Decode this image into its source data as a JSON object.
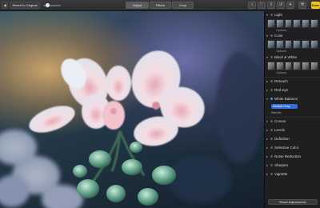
{
  "toolbar": {
    "left_label": "◀",
    "revert_label": "Revert to Original",
    "tabs": [
      {
        "label": "Adjust",
        "active": true
      },
      {
        "label": "Filters",
        "active": false
      },
      {
        "label": "Crop",
        "active": false
      }
    ],
    "right_icons": [
      "info-icon",
      "heart-icon",
      "share-icon",
      "rotate-icon",
      "enhance-icon",
      "wand-icon"
    ],
    "done_label": "Done",
    "zoom_level": 0.2
  },
  "panel": {
    "sections": [
      {
        "label": "Light",
        "has_thumbs": true,
        "options": "Options"
      },
      {
        "label": "Color",
        "has_thumbs": true,
        "options": "Options"
      },
      {
        "label": "Black & White",
        "has_thumbs": true,
        "options": "Options"
      },
      {
        "label": "Retouch"
      },
      {
        "label": "Red-eye"
      },
      {
        "label": "White Balance",
        "enabled": true
      },
      {
        "label": "Curves"
      },
      {
        "label": "Levels"
      },
      {
        "label": "Definition"
      },
      {
        "label": "Selective Color"
      },
      {
        "label": "Noise Reduction"
      },
      {
        "label": "Sharpen"
      },
      {
        "label": "Vignette"
      }
    ],
    "white_balance": {
      "mode": "Neutral Gray",
      "row_label": "Warmth",
      "row_value": ""
    },
    "reset_label": "Reset Adjustments"
  }
}
